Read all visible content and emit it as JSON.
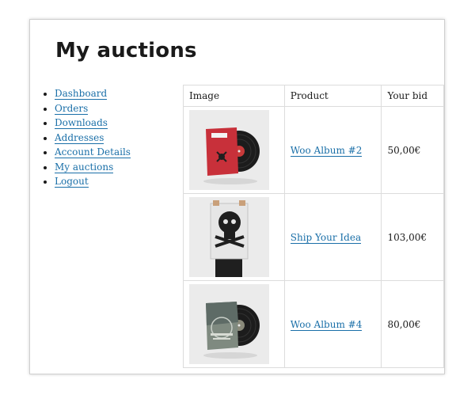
{
  "page": {
    "title": "My auctions"
  },
  "nav": {
    "items": [
      {
        "label": "Dashboard"
      },
      {
        "label": "Orders"
      },
      {
        "label": "Downloads"
      },
      {
        "label": "Addresses"
      },
      {
        "label": "Account Details"
      },
      {
        "label": "My auctions"
      },
      {
        "label": "Logout"
      }
    ]
  },
  "table": {
    "headers": {
      "image": "Image",
      "product": "Product",
      "bid": "Your bid"
    },
    "rows": [
      {
        "product": "Woo Album #2",
        "bid": "50,00€",
        "image_icon": "red-vinyl-record-icon"
      },
      {
        "product": "Ship Your Idea",
        "bid": "103,00€",
        "image_icon": "poster-skull-icon"
      },
      {
        "product": "Woo Album #4",
        "bid": "80,00€",
        "image_icon": "gray-vinyl-record-icon"
      }
    ]
  },
  "colors": {
    "link": "#1a6fa8",
    "border": "#dcdcdc",
    "thumb_bg": "#ececec"
  }
}
